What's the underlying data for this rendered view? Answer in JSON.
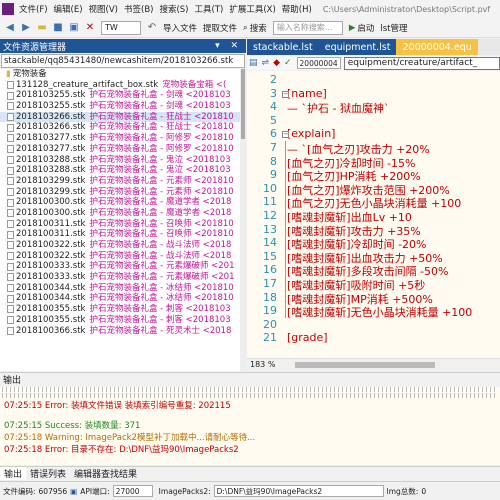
{
  "menubar": {
    "items": [
      "文件(F)",
      "编辑(E)",
      "视图(V)",
      "书签(B)",
      "搜索(S)",
      "工具(T)",
      "扩展工具(X)",
      "帮助(H)"
    ],
    "path": "C:\\Users\\Administrator\\Desktop\\Script.pvf"
  },
  "toolbar": {
    "combo": "TW",
    "import": "导入文件",
    "extract": "提取文件",
    "search_label": "搜索",
    "search_placeholder": "输入名称搜索...",
    "run": "启动",
    "lst": "lst管理"
  },
  "left_panel": {
    "title": "文件资源管理器",
    "path": "stackable/qq85431480/newcashitem/2018103266.stk",
    "folder": "宠物装备",
    "rows": [
      {
        "name": "131128_creature_artifact_box.stk",
        "desc": "宠物装备宝箱 <("
      },
      {
        "name": "2018103255.stk",
        "desc": "护石宠物装备礼盒 - 剑魂 <2018103"
      },
      {
        "name": "2018103255.stk",
        "desc": "护石宠物装备礼盒 - 剑魂 <2018103"
      },
      {
        "name": "2018103266.stk",
        "desc": "护石宠物装备礼盒 - 狂战士 <201810"
      },
      {
        "name": "2018103266.stk",
        "desc": "护石宠物装备礼盒 - 狂战士 <201810"
      },
      {
        "name": "2018103277.stk",
        "desc": "护石宠物装备礼盒 - 阿修罗 <201810"
      },
      {
        "name": "2018103277.stk",
        "desc": "护石宠物装备礼盒 - 阿修罗 <201810"
      },
      {
        "name": "2018103288.stk",
        "desc": "护石宠物装备礼盒 - 鬼泣 <2018103"
      },
      {
        "name": "2018103288.stk",
        "desc": "护石宠物装备礼盒 - 鬼泣 <2018103"
      },
      {
        "name": "2018103299.stk",
        "desc": "护石宠物装备礼盒 - 元素师 <201810"
      },
      {
        "name": "2018103299.stk",
        "desc": "护石宠物装备礼盒 - 元素师 <201810"
      },
      {
        "name": "2018100300.stk",
        "desc": "护石宠物装备礼盒 - 魔道学者 <2018"
      },
      {
        "name": "2018100300.stk",
        "desc": "护石宠物装备礼盒 - 魔道学者 <2018"
      },
      {
        "name": "2018100311.stk",
        "desc": "护石宠物装备礼盒 - 召唤师 <201810"
      },
      {
        "name": "2018100311.stk",
        "desc": "护石宠物装备礼盒 - 召唤师 <201810"
      },
      {
        "name": "2018100322.stk",
        "desc": "护石宠物装备礼盒 - 战斗法师 <2018"
      },
      {
        "name": "2018100322.stk",
        "desc": "护石宠物装备礼盒 - 战斗法师 <2018"
      },
      {
        "name": "2018100333.stk",
        "desc": "护石宠物装备礼盒 - 元素爆破师 <201"
      },
      {
        "name": "2018100333.stk",
        "desc": "护石宠物装备礼盒 - 元素爆破师 <201"
      },
      {
        "name": "2018100344.stk",
        "desc": "护石宠物装备礼盒 - 冰结师 <201810"
      },
      {
        "name": "2018100344.stk",
        "desc": "护石宠物装备礼盒 - 冰结师 <201810"
      },
      {
        "name": "2018100355.stk",
        "desc": "护石宠物装备礼盒 - 刺客 <2018103"
      },
      {
        "name": "2018100355.stk",
        "desc": "护石宠物装备礼盒 - 刺客 <2018103"
      },
      {
        "name": "2018100366.stk",
        "desc": "护石宠物装备礼盒 - 死灵术士 <2018"
      }
    ]
  },
  "editor": {
    "tabs": [
      "stackable.lst",
      "equipment.lst",
      "20000004.equ"
    ],
    "toolbar_field": "20000004",
    "toolbar_path": "equipment/creature/artifact_",
    "lines": [
      {
        "n": "2",
        "t": ""
      },
      {
        "n": "3",
        "t": "[name]"
      },
      {
        "n": "4",
        "t": "— `护石 - 狱血魔神`"
      },
      {
        "n": "5",
        "t": ""
      },
      {
        "n": "6",
        "t": "[explain]"
      },
      {
        "n": "7",
        "t": "— `[血气之刃]攻击力 +20%"
      },
      {
        "n": "8",
        "t": "[血气之刃]冷却时间 -15%"
      },
      {
        "n": "9",
        "t": "[血气之刃]HP消耗 +200%"
      },
      {
        "n": "10",
        "t": "[血气之刃]爆炸攻击范围 +200%"
      },
      {
        "n": "11",
        "t": "[血气之刃]无色小晶块消耗量 +100"
      },
      {
        "n": "12",
        "t": "[嗜魂封魔斩]出血Lv +10"
      },
      {
        "n": "13",
        "t": "[嗜魂封魔斩]攻击力 +35%"
      },
      {
        "n": "14",
        "t": "[嗜魂封魔斩]冷却时间 -20%"
      },
      {
        "n": "15",
        "t": "[嗜魂封魔斩]出血攻击力 +50%"
      },
      {
        "n": "16",
        "t": "[嗜魂封魔斩]多段攻击间隔 -50%"
      },
      {
        "n": "17",
        "t": "[嗜魂封魔斩]吸附时间 +5秒"
      },
      {
        "n": "18",
        "t": "[嗜魂封魔斩]MP消耗 +500%"
      },
      {
        "n": "19",
        "t": "[嗜魂封魔斩]无色小晶块消耗量 +100"
      },
      {
        "n": "20",
        "t": ""
      },
      {
        "n": "21",
        "t": "[grade]"
      }
    ],
    "zoom": "183 %"
  },
  "output": {
    "title": "输出",
    "lines": [
      {
        "t": "07:25:15 Error: 装填文件错误 装填索引编号重复: 202115",
        "c": "#c00000"
      },
      {
        "t": "07:25:15 Success: 装填数量: 371",
        "c": "#1f8a1f"
      },
      {
        "t": "07:25:18 Warning: ImagePack2模型补丁加载中...请耐心等待...",
        "c": "#b07000"
      },
      {
        "t": "07:25:18 Error: 目录不存在: D:\\DNF\\益玛90\\ImagePacks2",
        "c": "#c00000"
      }
    ],
    "tabs": [
      "输出",
      "错误列表",
      "编辑器查找结果"
    ]
  },
  "status": {
    "encoding_label": "文件编码:",
    "encoding": "607956",
    "api_label": "API端口:",
    "port": "27000",
    "imagepacks_label": "ImagePacks2:",
    "imagepacks_path": "D:\\DNF\\益玛90\\ImagePacks2",
    "lmg_label": "lmg总数:",
    "lmg": "0"
  }
}
